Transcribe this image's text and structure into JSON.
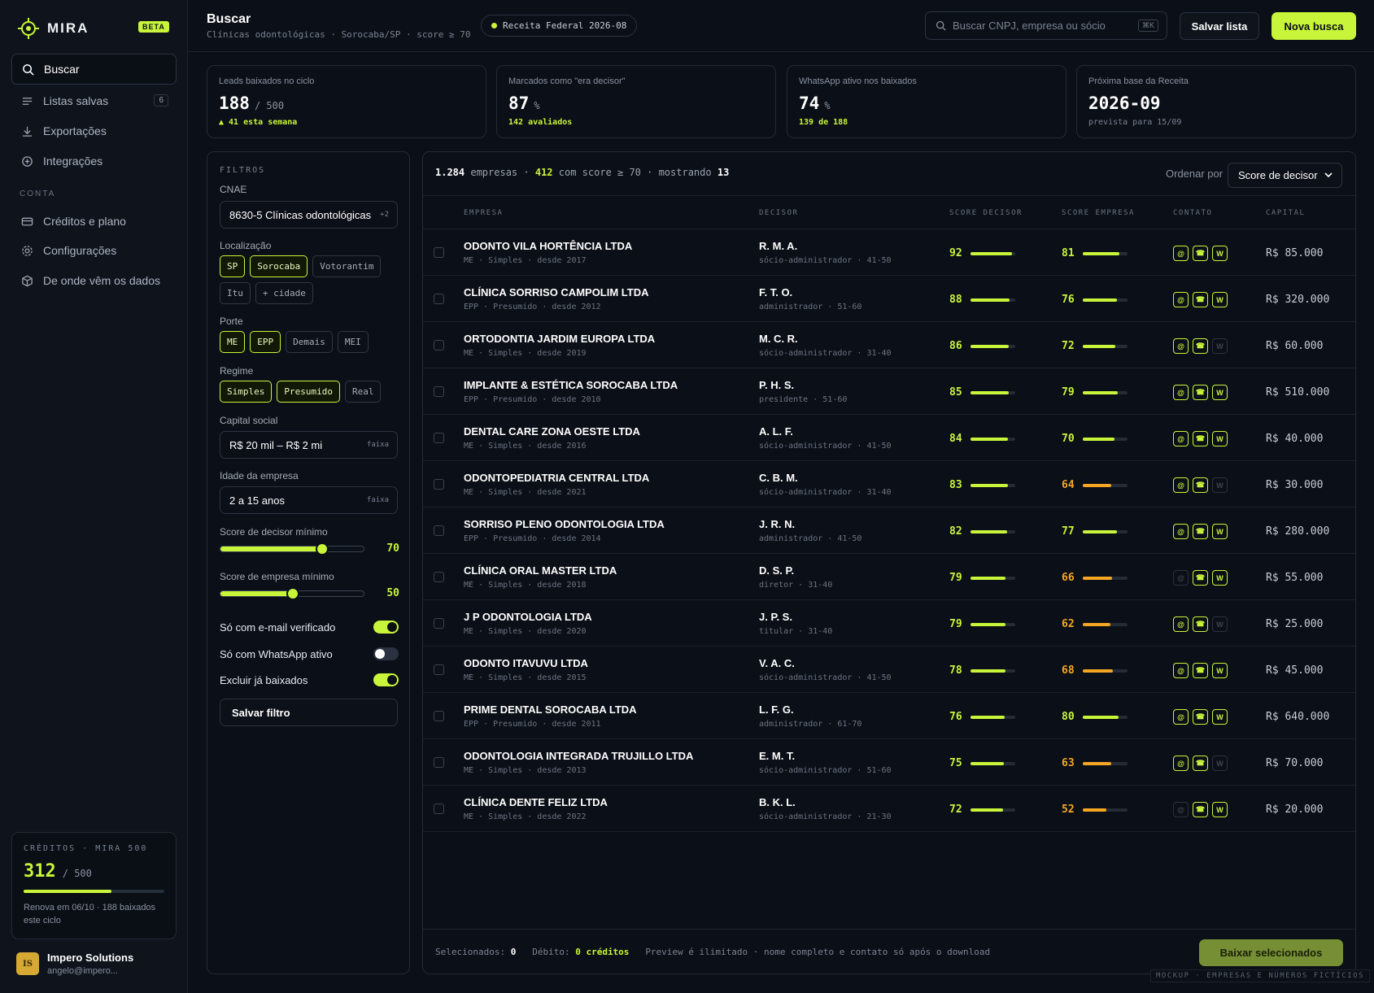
{
  "brand": {
    "name": "MIRA",
    "badge": "BETA"
  },
  "nav": [
    {
      "label": "Buscar",
      "icon": "search-icon",
      "active": true
    },
    {
      "label": "Listas salvas",
      "icon": "list-icon",
      "count": "6"
    },
    {
      "label": "Exportações",
      "icon": "download-icon"
    },
    {
      "label": "Integrações",
      "icon": "plus-circle-icon"
    }
  ],
  "account_label": "CONTA",
  "account_nav": [
    {
      "label": "Créditos e plano",
      "icon": "card-icon"
    },
    {
      "label": "Configurações",
      "icon": "gear-icon"
    },
    {
      "label": "De onde vêm os dados",
      "icon": "box-icon"
    }
  ],
  "credits": {
    "label": "CRÉDITOS · MIRA 500",
    "value": "312",
    "total": "/ 500",
    "fraction": 0.624,
    "note": "Renova em 06/10 · 188 baixados este ciclo"
  },
  "user": {
    "initials": "IS",
    "name": "Impero Solutions",
    "email": "angelo@impero..."
  },
  "header": {
    "title": "Buscar",
    "subtitle": "Clínicas odontológicas · Sorocaba/SP · score ≥ 70",
    "source_pill": "Receita Federal 2026-08",
    "search_placeholder": "Buscar CNPJ, empresa ou sócio",
    "search_kbd": "⌘K",
    "save_label": "Salvar lista",
    "new_label": "Nova busca"
  },
  "stats": [
    {
      "label": "Leads baixados no ciclo",
      "value": "188",
      "suffix": "/ 500",
      "sub": "▲ 41 esta semana",
      "sub_accent": true
    },
    {
      "label": "Marcados como \"era decisor\"",
      "value": "87",
      "suffix": "%",
      "sub": "142 avaliados",
      "sub_accent": true
    },
    {
      "label": "WhatsApp ativo nos baixados",
      "value": "74",
      "suffix": "%",
      "sub": "139 de 188",
      "sub_accent": true
    },
    {
      "label": "Próxima base da Receita",
      "value": "2026-09",
      "suffix": "",
      "sub": "prevista para 15/09",
      "sub_accent": false
    }
  ],
  "filters": {
    "title": "FILTROS",
    "cnae_label": "CNAE",
    "cnae_value": "8630-5 Clínicas odontológicas",
    "cnae_extra": "+2",
    "loc_label": "Localização",
    "loc_chips": [
      {
        "t": "SP",
        "on": true
      },
      {
        "t": "Sorocaba",
        "on": true
      },
      {
        "t": "Votorantim",
        "on": false
      },
      {
        "t": "Itu",
        "on": false
      },
      {
        "t": "+ cidade",
        "on": false
      }
    ],
    "porte_label": "Porte",
    "porte_chips": [
      {
        "t": "ME",
        "on": true
      },
      {
        "t": "EPP",
        "on": true
      },
      {
        "t": "Demais",
        "on": false
      },
      {
        "t": "MEI",
        "on": false
      }
    ],
    "regime_label": "Regime",
    "regime_chips": [
      {
        "t": "Simples",
        "on": true
      },
      {
        "t": "Presumido",
        "on": true
      },
      {
        "t": "Real",
        "on": false
      }
    ],
    "capital_label": "Capital social",
    "capital_value": "R$ 20 mil – R$ 2 mi",
    "capital_tag": "faixa",
    "age_label": "Idade da empresa",
    "age_value": "2 a 15 anos",
    "age_tag": "faixa",
    "dec_label": "Score de decisor mínimo",
    "dec_value": "70",
    "emp_label": "Score de empresa mínimo",
    "emp_value": "50",
    "toggles": [
      {
        "label": "Só com e-mail verificado",
        "on": true
      },
      {
        "label": "Só com WhatsApp ativo",
        "on": false
      },
      {
        "label": "Excluir já baixados",
        "on": true
      }
    ],
    "save_label": "Salvar filtro"
  },
  "results": {
    "count": "1.284",
    "count_label": "empresas ·",
    "scored": "412",
    "scored_label": "com score ≥ 70 · mostrando",
    "showing": "13",
    "sort_label": "Ordenar por",
    "sort_value": "Score de decisor",
    "columns": [
      "EMPRESA",
      "DECISOR",
      "SCORE DECISOR",
      "SCORE EMPRESA",
      "CONTATO",
      "CAPITAL"
    ],
    "rows": [
      {
        "name": "ODONTO VILA HORTÊNCIA LTDA",
        "meta": "ME · Simples · desde 2017",
        "dec": "R. M. A.",
        "role": "sócio-administrador · 41-50",
        "sd": 92,
        "se": 81,
        "c": [
          1,
          1,
          1
        ],
        "cap": "R$ 85.000"
      },
      {
        "name": "CLÍNICA SORRISO CAMPOLIM LTDA",
        "meta": "EPP · Presumido · desde 2012",
        "dec": "F. T. O.",
        "role": "administrador · 51-60",
        "sd": 88,
        "se": 76,
        "c": [
          1,
          1,
          1
        ],
        "cap": "R$ 320.000"
      },
      {
        "name": "ORTODONTIA JARDIM EUROPA LTDA",
        "meta": "ME · Simples · desde 2019",
        "dec": "M. C. R.",
        "role": "sócio-administrador · 31-40",
        "sd": 86,
        "se": 72,
        "c": [
          1,
          1,
          0
        ],
        "cap": "R$ 60.000"
      },
      {
        "name": "IMPLANTE & ESTÉTICA SOROCABA LTDA",
        "meta": "EPP · Presumido · desde 2010",
        "dec": "P. H. S.",
        "role": "presidente · 51-60",
        "sd": 85,
        "se": 79,
        "c": [
          1,
          1,
          1
        ],
        "cap": "R$ 510.000"
      },
      {
        "name": "DENTAL CARE ZONA OESTE LTDA",
        "meta": "ME · Simples · desde 2016",
        "dec": "A. L. F.",
        "role": "sócio-administrador · 41-50",
        "sd": 84,
        "se": 70,
        "c": [
          1,
          1,
          1
        ],
        "cap": "R$ 40.000"
      },
      {
        "name": "ODONTOPEDIATRIA CENTRAL LTDA",
        "meta": "ME · Simples · desde 2021",
        "dec": "C. B. M.",
        "role": "sócio-administrador · 31-40",
        "sd": 83,
        "se": 64,
        "c": [
          1,
          1,
          0
        ],
        "cap": "R$ 30.000"
      },
      {
        "name": "SORRISO PLENO ODONTOLOGIA LTDA",
        "meta": "EPP · Presumido · desde 2014",
        "dec": "J. R. N.",
        "role": "administrador · 41-50",
        "sd": 82,
        "se": 77,
        "c": [
          1,
          1,
          1
        ],
        "cap": "R$ 280.000"
      },
      {
        "name": "CLÍNICA ORAL MASTER LTDA",
        "meta": "ME · Simples · desde 2018",
        "dec": "D. S. P.",
        "role": "diretor · 31-40",
        "sd": 79,
        "se": 66,
        "c": [
          0,
          1,
          1
        ],
        "cap": "R$ 55.000"
      },
      {
        "name": "J P ODONTOLOGIA LTDA",
        "meta": "ME · Simples · desde 2020",
        "dec": "J. P. S.",
        "role": "titular · 31-40",
        "sd": 79,
        "se": 62,
        "c": [
          1,
          1,
          0
        ],
        "cap": "R$ 25.000"
      },
      {
        "name": "ODONTO ITAVUVU LTDA",
        "meta": "ME · Simples · desde 2015",
        "dec": "V. A. C.",
        "role": "sócio-administrador · 41-50",
        "sd": 78,
        "se": 68,
        "c": [
          1,
          1,
          1
        ],
        "cap": "R$ 45.000"
      },
      {
        "name": "PRIME DENTAL SOROCABA LTDA",
        "meta": "EPP · Presumido · desde 2011",
        "dec": "L. F. G.",
        "role": "administrador · 61-70",
        "sd": 76,
        "se": 80,
        "c": [
          1,
          1,
          1
        ],
        "cap": "R$ 640.000"
      },
      {
        "name": "ODONTOLOGIA INTEGRADA TRUJILLO LTDA",
        "meta": "ME · Simples · desde 2013",
        "dec": "E. M. T.",
        "role": "sócio-administrador · 51-60",
        "sd": 75,
        "se": 63,
        "c": [
          1,
          1,
          0
        ],
        "cap": "R$ 70.000"
      },
      {
        "name": "CLÍNICA DENTE FELIZ LTDA",
        "meta": "ME · Simples · desde 2022",
        "dec": "B. K. L.",
        "role": "sócio-administrador · 21-30",
        "sd": 72,
        "se": 52,
        "c": [
          0,
          1,
          1
        ],
        "cap": "R$ 20.000"
      }
    ],
    "contact_glyphs": [
      "@",
      "☎",
      "W"
    ],
    "footer_selected_label": "Selecionados:",
    "footer_selected": "0",
    "footer_debit_label": "Débito:",
    "footer_debit": "0 créditos",
    "footer_note": "Preview é ilimitado · nome completo e contato só após o download",
    "download_label": "Baixar selecionados"
  },
  "mockup_note": "MOCKUP · EMPRESAS E NÚMEROS FICTÍCIOS",
  "colors": {
    "accent": "#c8f53a",
    "warn": "#f5a623",
    "bg": "#0b0f17"
  }
}
